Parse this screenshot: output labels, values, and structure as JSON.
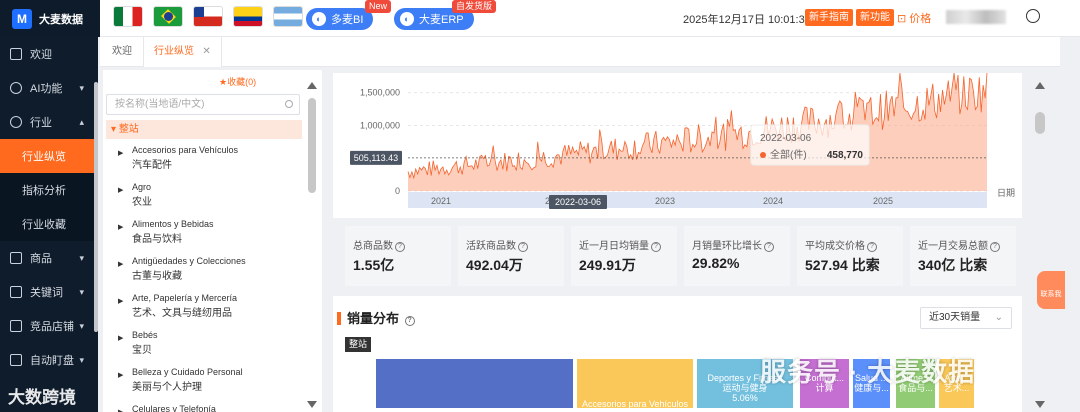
{
  "app": {
    "logo_text": "大麦数据"
  },
  "header": {
    "products": [
      {
        "label": "多麦BI",
        "badge": "New"
      },
      {
        "label": "大麦ERP",
        "badge": "自发货版"
      }
    ],
    "datetime": "2025年12月17日 10:01:36",
    "newbie_label": "新手指南",
    "newfeature_label": "新功能",
    "price_label": "价格"
  },
  "nav": {
    "items": [
      {
        "label": "欢迎",
        "icon": "book-icon"
      },
      {
        "label": "AI功能",
        "icon": "ai-icon"
      },
      {
        "label": "行业",
        "icon": "target-icon"
      }
    ],
    "sub_items": [
      "行业纵览",
      "指标分析",
      "行业收藏"
    ],
    "items_after": [
      {
        "label": "商品",
        "icon": "box-icon"
      },
      {
        "label": "关键词",
        "icon": "doc-icon"
      },
      {
        "label": "竞品店铺",
        "icon": "store-icon"
      },
      {
        "label": "自动盯盘",
        "icon": "monitor-icon"
      }
    ]
  },
  "tabs": {
    "welcome": "欢迎",
    "active": "行业纵览",
    "close": "✕"
  },
  "category": {
    "favorites": "★收藏(0)",
    "search_placeholder": "按名称(当地语/中文)",
    "root": "整站",
    "items": [
      {
        "es": "Accesorios para Vehículos",
        "zh": "汽车配件"
      },
      {
        "es": "Agro",
        "zh": "农业"
      },
      {
        "es": "Alimentos y Bebidas",
        "zh": "食品与饮料"
      },
      {
        "es": "Antigüedades y Colecciones",
        "zh": "古董与收藏"
      },
      {
        "es": "Arte, Papelería y Mercería",
        "zh": "艺术、文具与缝纫用品"
      },
      {
        "es": "Bebés",
        "zh": "宝贝"
      },
      {
        "es": "Belleza y Cuidado Personal",
        "zh": "美丽与个人护理"
      },
      {
        "es": "Celulares y Telefonía",
        "zh": ""
      }
    ]
  },
  "chart_data": {
    "type": "area",
    "y_ticks": [
      "1,500,000",
      "1,000,000",
      "0"
    ],
    "x_ticks": [
      "2021",
      "2022",
      "2023",
      "2024",
      "2025"
    ],
    "x_axis_suffix": "日期",
    "ylim": [
      0,
      1800000
    ],
    "crosshair_y_label": "505,113.43",
    "tooltip": {
      "date": "2022-03-06",
      "series": "全部(件)",
      "value": "458,770"
    },
    "slider_date": "2022-03-06",
    "color": "#f4642e"
  },
  "metrics": [
    {
      "label": "总商品数",
      "value": "1.55亿"
    },
    {
      "label": "活跃商品数",
      "value": "492.04万"
    },
    {
      "label": "近一月日均销量",
      "value": "249.91万"
    },
    {
      "label": "月销量环比增长",
      "value": "29.82%"
    },
    {
      "label": "平均成交价格",
      "value": "527.94 比索"
    },
    {
      "label": "近一月交易总额",
      "value": "340亿 比索"
    }
  ],
  "distribution": {
    "title": "销量分布",
    "range_select": "近30天销量",
    "root_tag": "整站",
    "tiles": [
      {
        "label": "",
        "sub": "",
        "pct": "",
        "color": "#5470c6"
      },
      {
        "label": "Accesorios para Vehículos",
        "sub": "",
        "pct": "",
        "color": "#fac858"
      },
      {
        "label": "Deportes y Fitness",
        "sub": "运动与健身",
        "pct": "5.06%",
        "color": "#73c0de"
      },
      {
        "label": "Comput...",
        "sub": "计算",
        "pct": "",
        "color": "#c46fd1"
      },
      {
        "label": "Salud ...",
        "sub": "健康与...",
        "pct": "",
        "color": "#5b8ff9"
      },
      {
        "label": "Alime...",
        "sub": "食品与...",
        "pct": "",
        "color": "#91cc75"
      },
      {
        "label": "Arte...",
        "sub": "艺术...",
        "pct": "",
        "color": "#fac858"
      }
    ]
  },
  "contact": {
    "label": "联系我"
  },
  "watermarks": {
    "left": "大数跨境",
    "right": "服务号 · 大麦数据"
  }
}
